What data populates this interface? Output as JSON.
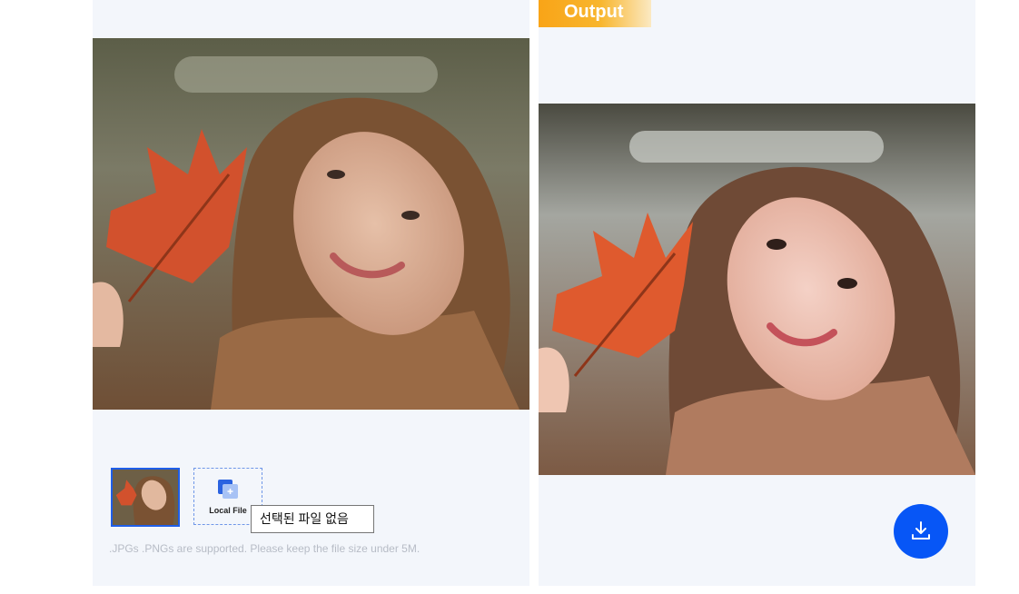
{
  "input_panel": {
    "photo_icon": "woman-with-maple-leaf-photo",
    "thumbnail_icon": "selected-photo-thumbnail",
    "local_file": {
      "label": "Local File",
      "icon": "add-file-icon"
    },
    "file_input_status": "선택된 파일 없음",
    "hint": ".JPGs .PNGs are supported. Please keep the file size under 5M."
  },
  "output_panel": {
    "badge": "Output",
    "photo_icon": "painted-portrait-output-photo",
    "download_icon": "download-icon"
  },
  "colors": {
    "accent": "#0756f6",
    "badge_gradient_start": "#f9a417",
    "panel_bg": "#f3f6fb",
    "hint_text": "#b7bcc6"
  }
}
